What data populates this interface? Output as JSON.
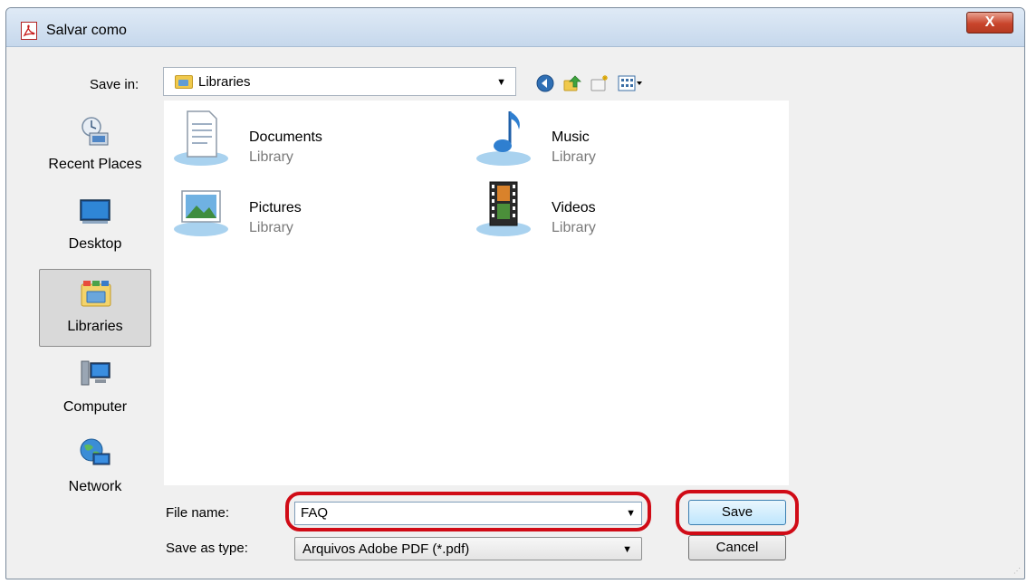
{
  "title": "Salvar como",
  "close_label": "X",
  "save_in": {
    "label": "Save in:",
    "value": "Libraries"
  },
  "sidebar": {
    "items": [
      {
        "label": "Recent Places",
        "icon": "recent-places-icon"
      },
      {
        "label": "Desktop",
        "icon": "desktop-icon"
      },
      {
        "label": "Libraries",
        "icon": "libraries-icon",
        "selected": true
      },
      {
        "label": "Computer",
        "icon": "computer-icon"
      },
      {
        "label": "Network",
        "icon": "network-icon"
      }
    ]
  },
  "files": [
    {
      "name": "Documents",
      "type": "Library",
      "icon": "documents-library-icon"
    },
    {
      "name": "Music",
      "type": "Library",
      "icon": "music-library-icon"
    },
    {
      "name": "Pictures",
      "type": "Library",
      "icon": "pictures-library-icon"
    },
    {
      "name": "Videos",
      "type": "Library",
      "icon": "videos-library-icon"
    }
  ],
  "file_name": {
    "label": "File name:",
    "value": "FAQ"
  },
  "save_as_type": {
    "label": "Save as type:",
    "value": "Arquivos Adobe PDF (*.pdf)"
  },
  "buttons": {
    "save": "Save",
    "cancel": "Cancel"
  },
  "colors": {
    "highlight_ring": "#d00b16",
    "selected_bg": "#d9d9d9"
  }
}
